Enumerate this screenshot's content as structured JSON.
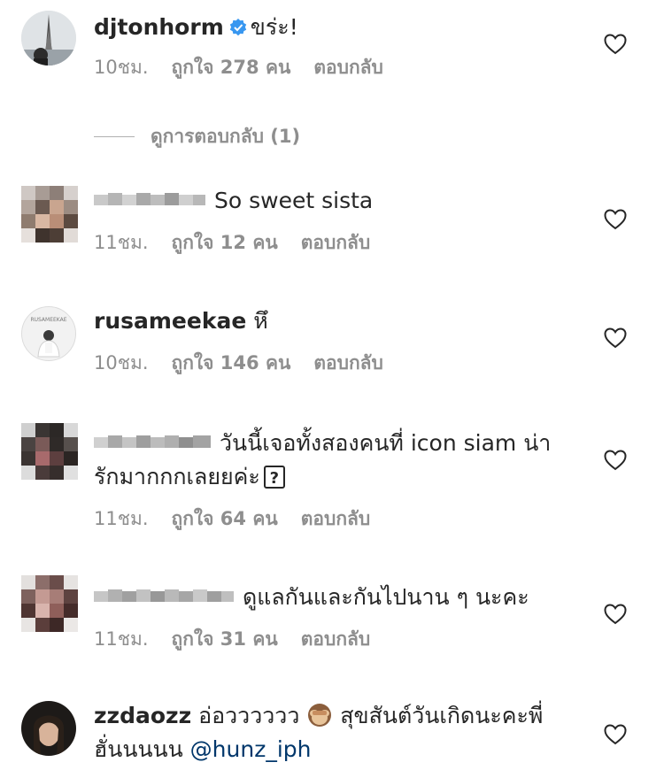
{
  "comments": [
    {
      "username": "djtonhorm",
      "text": "ขร่ะ!",
      "time": "10ชม.",
      "likes": "ถูกใจ 278 คน",
      "reply": "ตอบกลับ"
    },
    {
      "text": "So sweet sista",
      "time": "11ชม.",
      "likes": "ถูกใจ 12 คน",
      "reply": "ตอบกลับ"
    },
    {
      "username": "rusameekae",
      "text": "หึ",
      "time": "10ชม.",
      "likes": "ถูกใจ 146 คน",
      "reply": "ตอบกลับ"
    },
    {
      "text_line1": "วันนี้เจอทั้งสองคนที่ icon siam น่า",
      "text_line2": "รักมากกกเลยยค่ะ",
      "time": "11ชม.",
      "likes": "ถูกใจ 64 คน",
      "reply": "ตอบกลับ"
    },
    {
      "text": "ดูแลกันและกันไปนาน ๆ นะคะ",
      "time": "11ชม.",
      "likes": "ถูกใจ 31 คน",
      "reply": "ตอบกลับ"
    },
    {
      "username": "zzdaozz",
      "text_line1": "อ่อวววววว",
      "text_line1b": "สุขสันต์วันเกิดนะคะพี่",
      "text_line2": "ฮั่นนนนน",
      "mention": "@hunz_iph"
    }
  ],
  "view_replies": "ดูการตอบกลับ (1)",
  "avatar_caption": "RUSAMEEKAE",
  "colors": {
    "verified": "#3897f0",
    "meta": "#8e8e8e",
    "mention": "#00376b"
  }
}
